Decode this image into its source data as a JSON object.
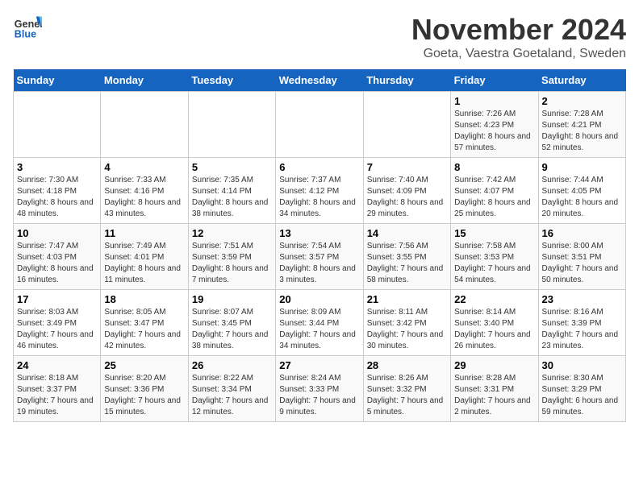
{
  "logo": {
    "general": "General",
    "blue": "Blue"
  },
  "header": {
    "month": "November 2024",
    "location": "Goeta, Vaestra Goetaland, Sweden"
  },
  "weekdays": [
    "Sunday",
    "Monday",
    "Tuesday",
    "Wednesday",
    "Thursday",
    "Friday",
    "Saturday"
  ],
  "weeks": [
    [
      {
        "day": "",
        "sunrise": "",
        "sunset": "",
        "daylight": ""
      },
      {
        "day": "",
        "sunrise": "",
        "sunset": "",
        "daylight": ""
      },
      {
        "day": "",
        "sunrise": "",
        "sunset": "",
        "daylight": ""
      },
      {
        "day": "",
        "sunrise": "",
        "sunset": "",
        "daylight": ""
      },
      {
        "day": "",
        "sunrise": "",
        "sunset": "",
        "daylight": ""
      },
      {
        "day": "1",
        "sunrise": "Sunrise: 7:26 AM",
        "sunset": "Sunset: 4:23 PM",
        "daylight": "Daylight: 8 hours and 57 minutes."
      },
      {
        "day": "2",
        "sunrise": "Sunrise: 7:28 AM",
        "sunset": "Sunset: 4:21 PM",
        "daylight": "Daylight: 8 hours and 52 minutes."
      }
    ],
    [
      {
        "day": "3",
        "sunrise": "Sunrise: 7:30 AM",
        "sunset": "Sunset: 4:18 PM",
        "daylight": "Daylight: 8 hours and 48 minutes."
      },
      {
        "day": "4",
        "sunrise": "Sunrise: 7:33 AM",
        "sunset": "Sunset: 4:16 PM",
        "daylight": "Daylight: 8 hours and 43 minutes."
      },
      {
        "day": "5",
        "sunrise": "Sunrise: 7:35 AM",
        "sunset": "Sunset: 4:14 PM",
        "daylight": "Daylight: 8 hours and 38 minutes."
      },
      {
        "day": "6",
        "sunrise": "Sunrise: 7:37 AM",
        "sunset": "Sunset: 4:12 PM",
        "daylight": "Daylight: 8 hours and 34 minutes."
      },
      {
        "day": "7",
        "sunrise": "Sunrise: 7:40 AM",
        "sunset": "Sunset: 4:09 PM",
        "daylight": "Daylight: 8 hours and 29 minutes."
      },
      {
        "day": "8",
        "sunrise": "Sunrise: 7:42 AM",
        "sunset": "Sunset: 4:07 PM",
        "daylight": "Daylight: 8 hours and 25 minutes."
      },
      {
        "day": "9",
        "sunrise": "Sunrise: 7:44 AM",
        "sunset": "Sunset: 4:05 PM",
        "daylight": "Daylight: 8 hours and 20 minutes."
      }
    ],
    [
      {
        "day": "10",
        "sunrise": "Sunrise: 7:47 AM",
        "sunset": "Sunset: 4:03 PM",
        "daylight": "Daylight: 8 hours and 16 minutes."
      },
      {
        "day": "11",
        "sunrise": "Sunrise: 7:49 AM",
        "sunset": "Sunset: 4:01 PM",
        "daylight": "Daylight: 8 hours and 11 minutes."
      },
      {
        "day": "12",
        "sunrise": "Sunrise: 7:51 AM",
        "sunset": "Sunset: 3:59 PM",
        "daylight": "Daylight: 8 hours and 7 minutes."
      },
      {
        "day": "13",
        "sunrise": "Sunrise: 7:54 AM",
        "sunset": "Sunset: 3:57 PM",
        "daylight": "Daylight: 8 hours and 3 minutes."
      },
      {
        "day": "14",
        "sunrise": "Sunrise: 7:56 AM",
        "sunset": "Sunset: 3:55 PM",
        "daylight": "Daylight: 7 hours and 58 minutes."
      },
      {
        "day": "15",
        "sunrise": "Sunrise: 7:58 AM",
        "sunset": "Sunset: 3:53 PM",
        "daylight": "Daylight: 7 hours and 54 minutes."
      },
      {
        "day": "16",
        "sunrise": "Sunrise: 8:00 AM",
        "sunset": "Sunset: 3:51 PM",
        "daylight": "Daylight: 7 hours and 50 minutes."
      }
    ],
    [
      {
        "day": "17",
        "sunrise": "Sunrise: 8:03 AM",
        "sunset": "Sunset: 3:49 PM",
        "daylight": "Daylight: 7 hours and 46 minutes."
      },
      {
        "day": "18",
        "sunrise": "Sunrise: 8:05 AM",
        "sunset": "Sunset: 3:47 PM",
        "daylight": "Daylight: 7 hours and 42 minutes."
      },
      {
        "day": "19",
        "sunrise": "Sunrise: 8:07 AM",
        "sunset": "Sunset: 3:45 PM",
        "daylight": "Daylight: 7 hours and 38 minutes."
      },
      {
        "day": "20",
        "sunrise": "Sunrise: 8:09 AM",
        "sunset": "Sunset: 3:44 PM",
        "daylight": "Daylight: 7 hours and 34 minutes."
      },
      {
        "day": "21",
        "sunrise": "Sunrise: 8:11 AM",
        "sunset": "Sunset: 3:42 PM",
        "daylight": "Daylight: 7 hours and 30 minutes."
      },
      {
        "day": "22",
        "sunrise": "Sunrise: 8:14 AM",
        "sunset": "Sunset: 3:40 PM",
        "daylight": "Daylight: 7 hours and 26 minutes."
      },
      {
        "day": "23",
        "sunrise": "Sunrise: 8:16 AM",
        "sunset": "Sunset: 3:39 PM",
        "daylight": "Daylight: 7 hours and 23 minutes."
      }
    ],
    [
      {
        "day": "24",
        "sunrise": "Sunrise: 8:18 AM",
        "sunset": "Sunset: 3:37 PM",
        "daylight": "Daylight: 7 hours and 19 minutes."
      },
      {
        "day": "25",
        "sunrise": "Sunrise: 8:20 AM",
        "sunset": "Sunset: 3:36 PM",
        "daylight": "Daylight: 7 hours and 15 minutes."
      },
      {
        "day": "26",
        "sunrise": "Sunrise: 8:22 AM",
        "sunset": "Sunset: 3:34 PM",
        "daylight": "Daylight: 7 hours and 12 minutes."
      },
      {
        "day": "27",
        "sunrise": "Sunrise: 8:24 AM",
        "sunset": "Sunset: 3:33 PM",
        "daylight": "Daylight: 7 hours and 9 minutes."
      },
      {
        "day": "28",
        "sunrise": "Sunrise: 8:26 AM",
        "sunset": "Sunset: 3:32 PM",
        "daylight": "Daylight: 7 hours and 5 minutes."
      },
      {
        "day": "29",
        "sunrise": "Sunrise: 8:28 AM",
        "sunset": "Sunset: 3:31 PM",
        "daylight": "Daylight: 7 hours and 2 minutes."
      },
      {
        "day": "30",
        "sunrise": "Sunrise: 8:30 AM",
        "sunset": "Sunset: 3:29 PM",
        "daylight": "Daylight: 6 hours and 59 minutes."
      }
    ]
  ]
}
